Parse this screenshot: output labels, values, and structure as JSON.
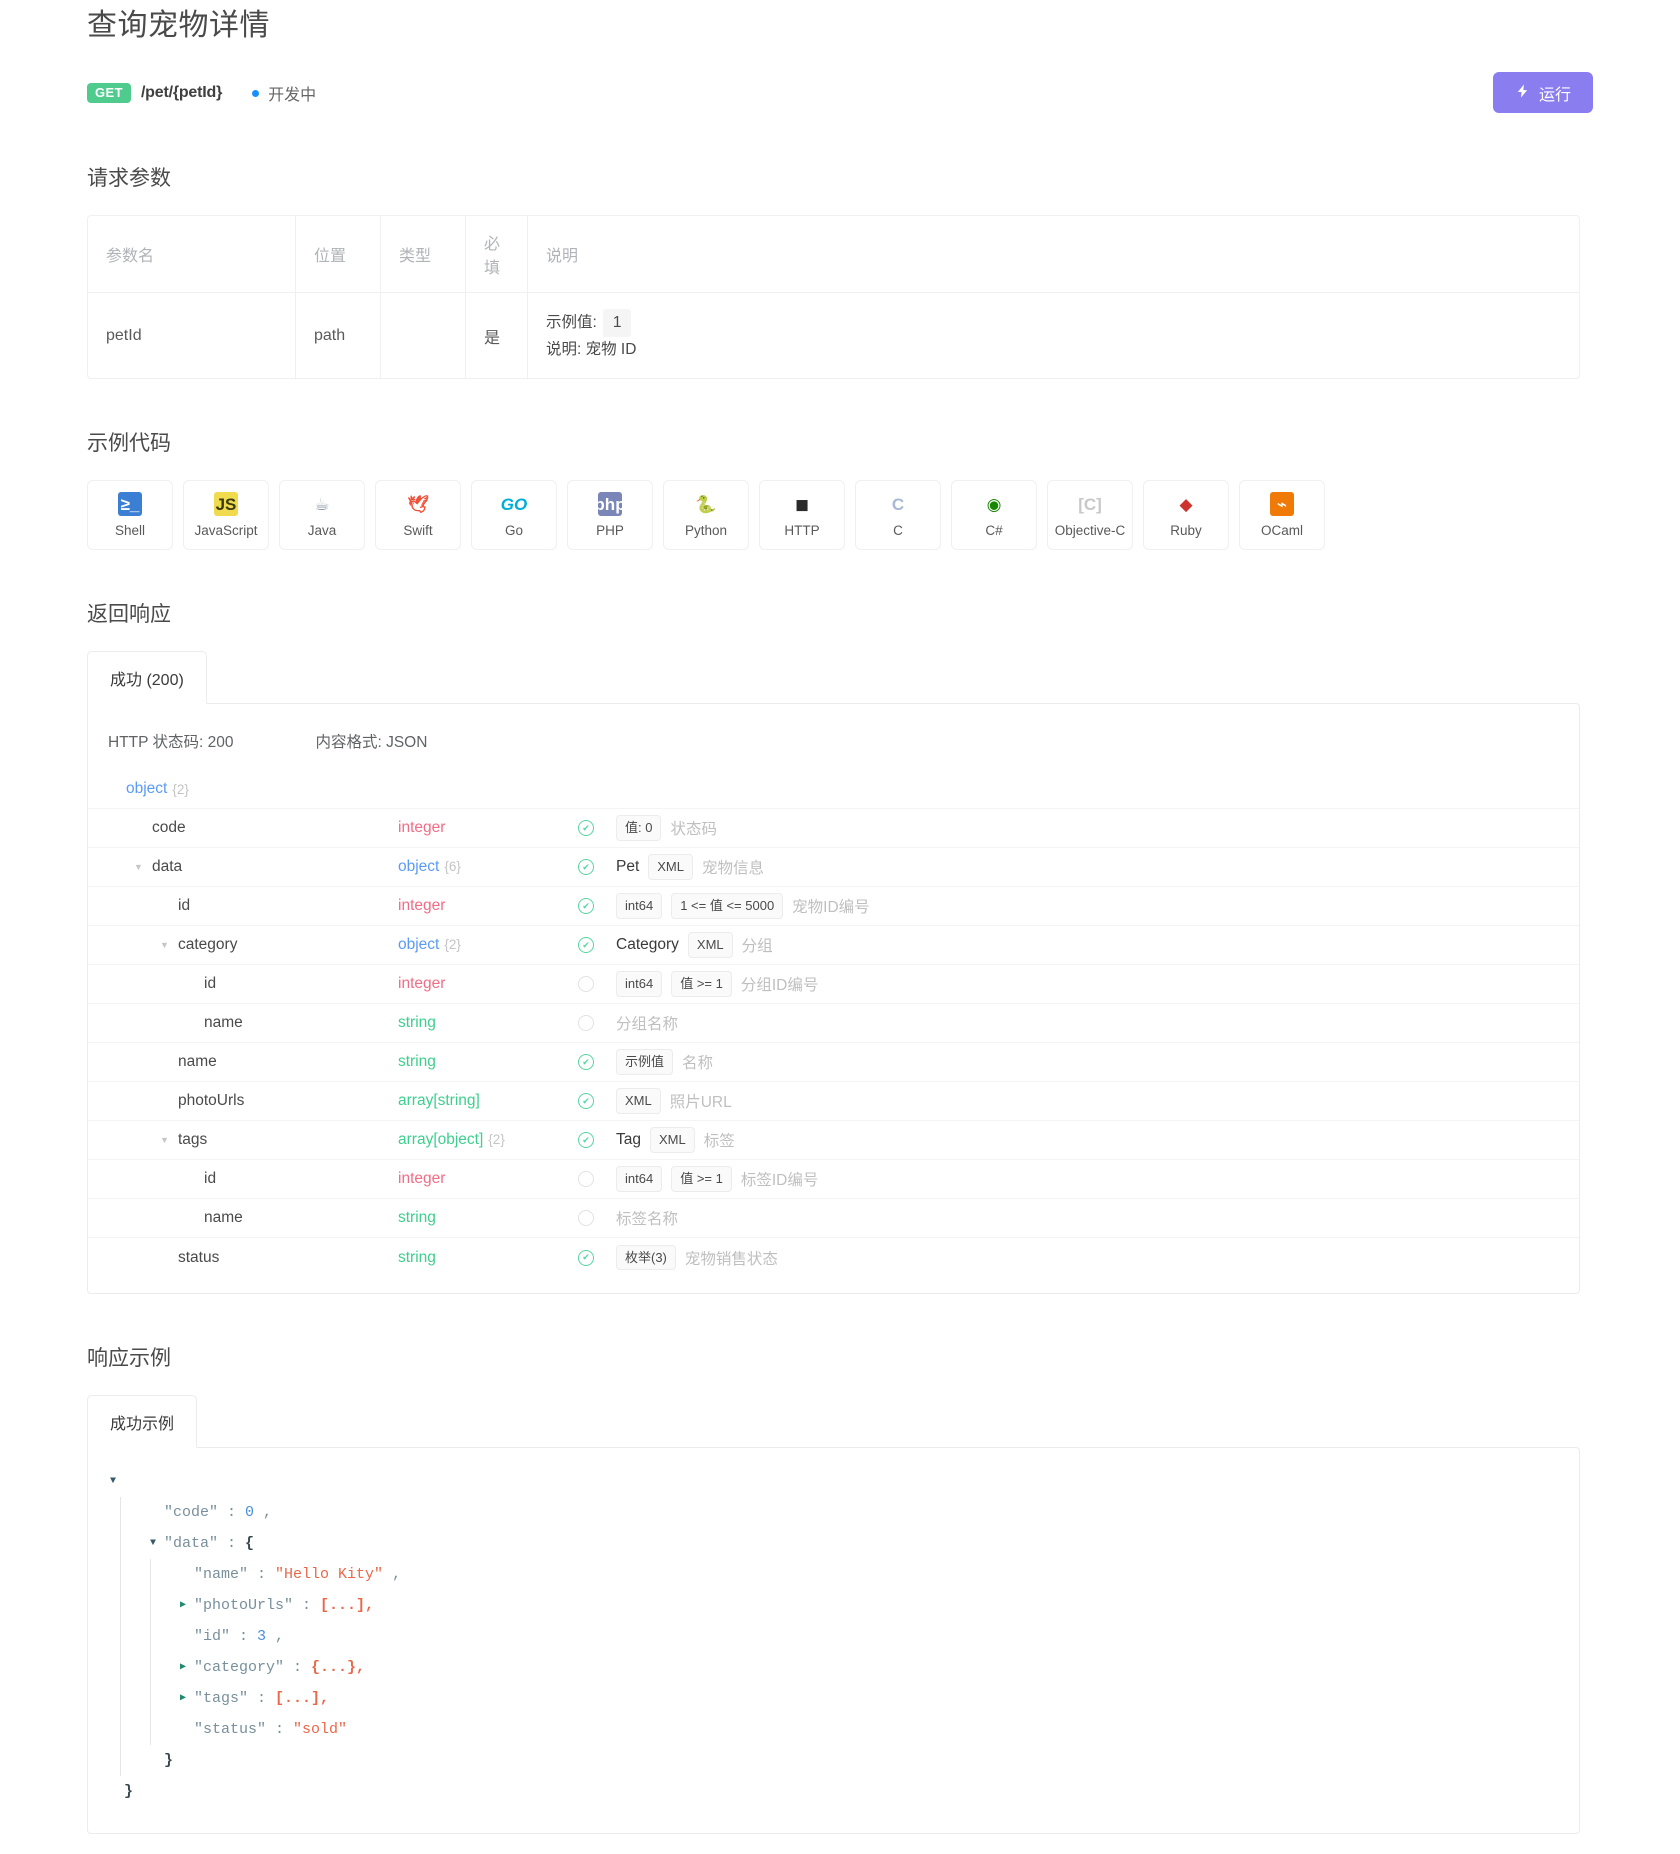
{
  "header": {
    "title": "查询宠物详情",
    "method": "GET",
    "path": "/pet/{petId}",
    "status": "开发中",
    "run_label": "运行",
    "run_icon": "bolt-icon"
  },
  "request_params": {
    "section_title": "请求参数",
    "columns": [
      "参数名",
      "位置",
      "类型",
      "必填",
      "说明"
    ],
    "rows": [
      {
        "name": "petId",
        "location": "path",
        "type": "",
        "required": "是",
        "example_label": "示例值:",
        "example_value": "1",
        "desc_label": "说明:",
        "desc_value": "宠物 ID"
      }
    ]
  },
  "sample_code": {
    "section_title": "示例代码",
    "languages": [
      {
        "label": "Shell",
        "icon": "powershell-icon",
        "glyph": "≥_"
      },
      {
        "label": "JavaScript",
        "icon": "javascript-icon",
        "glyph": "JS"
      },
      {
        "label": "Java",
        "icon": "java-icon",
        "glyph": "☕"
      },
      {
        "label": "Swift",
        "icon": "swift-icon",
        "glyph": "🕊"
      },
      {
        "label": "Go",
        "icon": "go-icon",
        "glyph": "GO"
      },
      {
        "label": "PHP",
        "icon": "php-icon",
        "glyph": "php"
      },
      {
        "label": "Python",
        "icon": "python-icon",
        "glyph": "🐍"
      },
      {
        "label": "HTTP",
        "icon": "http-icon",
        "glyph": "◼"
      },
      {
        "label": "C",
        "icon": "c-icon",
        "glyph": "C"
      },
      {
        "label": "C#",
        "icon": "csharp-icon",
        "glyph": "◉"
      },
      {
        "label": "Objective-C",
        "icon": "objective-c-icon",
        "glyph": "[C]"
      },
      {
        "label": "Ruby",
        "icon": "ruby-icon",
        "glyph": "◆"
      },
      {
        "label": "OCaml",
        "icon": "ocaml-icon",
        "glyph": "⌁"
      }
    ]
  },
  "response": {
    "section_title": "返回响应",
    "tab_label": "成功 (200)",
    "http_status": "HTTP 状态码: 200",
    "content_type": "内容格式: JSON",
    "schema": [
      {
        "indent": 0,
        "caret": "none",
        "key": "object",
        "key_style": "type-root",
        "type": "",
        "type_class": "t-object",
        "count": "{2}",
        "required": null,
        "model": "",
        "chips": [],
        "desc": ""
      },
      {
        "indent": 1,
        "caret": "none",
        "key": "code",
        "type": "integer",
        "type_class": "t-integer",
        "count": "",
        "required": true,
        "model": "",
        "chips": [
          "值: 0"
        ],
        "desc": "状态码"
      },
      {
        "indent": 1,
        "caret": "down",
        "key": "data",
        "type": "object",
        "type_class": "t-object",
        "count": "{6}",
        "required": true,
        "model": "Pet",
        "chips": [
          "XML"
        ],
        "desc": "宠物信息"
      },
      {
        "indent": 2,
        "caret": "none",
        "key": "id",
        "type": "integer",
        "type_class": "t-integer",
        "count": "",
        "required": true,
        "model": "",
        "chips": [
          "int64",
          "1 <= 值 <= 5000"
        ],
        "desc": "宠物ID编号"
      },
      {
        "indent": 2,
        "caret": "down",
        "key": "category",
        "type": "object",
        "type_class": "t-object",
        "count": "{2}",
        "required": true,
        "model": "Category",
        "chips": [
          "XML"
        ],
        "desc": "分组"
      },
      {
        "indent": 3,
        "caret": "none",
        "key": "id",
        "type": "integer",
        "type_class": "t-integer",
        "count": "",
        "required": false,
        "model": "",
        "chips": [
          "int64",
          "值 >= 1"
        ],
        "desc": "分组ID编号"
      },
      {
        "indent": 3,
        "caret": "none",
        "key": "name",
        "type": "string",
        "type_class": "t-string",
        "count": "",
        "required": false,
        "model": "",
        "chips": [],
        "desc": "分组名称"
      },
      {
        "indent": 2,
        "caret": "none",
        "key": "name",
        "type": "string",
        "type_class": "t-string",
        "count": "",
        "required": true,
        "model": "",
        "chips": [
          "示例值"
        ],
        "desc": "名称"
      },
      {
        "indent": 2,
        "caret": "none",
        "key": "photoUrls",
        "type": "array[string]",
        "type_class": "t-array",
        "count": "",
        "required": true,
        "model": "",
        "chips": [
          "XML"
        ],
        "desc": "照片URL"
      },
      {
        "indent": 2,
        "caret": "down",
        "key": "tags",
        "type": "array[object]",
        "type_class": "t-array",
        "count": "{2}",
        "required": true,
        "model": "Tag",
        "chips": [
          "XML"
        ],
        "desc": "标签"
      },
      {
        "indent": 3,
        "caret": "none",
        "key": "id",
        "type": "integer",
        "type_class": "t-integer",
        "count": "",
        "required": false,
        "model": "",
        "chips": [
          "int64",
          "值 >= 1"
        ],
        "desc": "标签ID编号"
      },
      {
        "indent": 3,
        "caret": "none",
        "key": "name",
        "type": "string",
        "type_class": "t-string",
        "count": "",
        "required": false,
        "model": "",
        "chips": [],
        "desc": "标签名称"
      },
      {
        "indent": 2,
        "caret": "none",
        "key": "status",
        "type": "string",
        "type_class": "t-string",
        "count": "",
        "required": true,
        "model": "",
        "chips": [
          "枚举(3)"
        ],
        "desc": "宠物销售状态"
      }
    ]
  },
  "response_example": {
    "section_title": "响应示例",
    "tab_label": "成功示例",
    "json_lines": [
      {
        "indent": 0,
        "caret": "down",
        "text": "{"
      },
      {
        "indent": 1,
        "caret": "none",
        "key": "\"code\"",
        "sep": " : ",
        "value": "0",
        "value_type": "num",
        "tail": " ,"
      },
      {
        "indent": 1,
        "caret": "down",
        "key": "\"data\"",
        "sep": " : ",
        "value": "{",
        "value_type": "brace",
        "tail": ""
      },
      {
        "indent": 2,
        "caret": "none",
        "key": "\"name\"",
        "sep": " : ",
        "value": "\"Hello Kity\"",
        "value_type": "str",
        "tail": " ,"
      },
      {
        "indent": 2,
        "caret": "right",
        "key": "\"photoUrls\"",
        "sep": " : ",
        "value": "[...],",
        "value_type": "dots",
        "tail": ""
      },
      {
        "indent": 2,
        "caret": "none",
        "key": "\"id\"",
        "sep": " : ",
        "value": "3",
        "value_type": "num",
        "tail": " ,"
      },
      {
        "indent": 2,
        "caret": "right",
        "key": "\"category\"",
        "sep": " : ",
        "value": "{...},",
        "value_type": "dots",
        "tail": ""
      },
      {
        "indent": 2,
        "caret": "right",
        "key": "\"tags\"",
        "sep": " : ",
        "value": "[...],",
        "value_type": "dots",
        "tail": ""
      },
      {
        "indent": 2,
        "caret": "none",
        "key": "\"status\"",
        "sep": " : ",
        "value": "\"sold\"",
        "value_type": "str",
        "tail": ""
      },
      {
        "indent": 1,
        "caret": "none",
        "key": "",
        "sep": "",
        "value": "}",
        "value_type": "brace",
        "tail": ""
      },
      {
        "indent": 0,
        "caret": "none",
        "key": "",
        "sep": "",
        "value": "}",
        "value_type": "brace",
        "tail": ""
      }
    ]
  },
  "colors": {
    "method_green": "#4ecb8d",
    "run_purple": "#8a7df0",
    "status_blue": "#1890ff",
    "type_object": "#5b9bf5",
    "type_integer": "#ef6d86",
    "type_string": "#3ecf8e",
    "check_green": "#56d6a0"
  }
}
